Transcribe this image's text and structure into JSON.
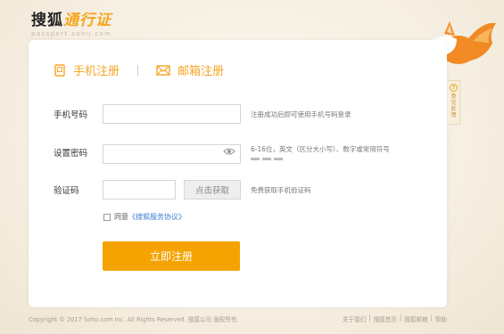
{
  "logo": {
    "brand": "搜狐",
    "product": "通行证",
    "sub": "passport.sohu.com"
  },
  "tabs": [
    {
      "label": "手机注册",
      "icon": "phone-icon"
    },
    {
      "label": "邮箱注册",
      "icon": "mail-icon"
    }
  ],
  "form": {
    "phone": {
      "label": "手机号码",
      "value": "",
      "hint": "注册成功后即可使用手机号码登录"
    },
    "password": {
      "label": "设置密码",
      "value": "",
      "hint": "6-16位，英文（区分大小写）、数字或常用符号"
    },
    "code": {
      "label": "验证码",
      "value": "",
      "button": "点击获取",
      "hint": "免费获取手机验证码"
    },
    "agree": {
      "text": "同意",
      "link": "《搜狐服务协议》",
      "checked": false
    },
    "submit": "立即注册"
  },
  "side_tab": {
    "icon": "question-icon",
    "text": "意见反馈"
  },
  "footer": {
    "copyright": "Copyright © 2017 Sohu.com Inc. All Rights Reserved. 搜狐公司 版权所有",
    "links": [
      "关于我们",
      "搜狐首页",
      "搜狐邮箱",
      "帮助"
    ],
    "separator": "|"
  },
  "colors": {
    "accent": "#f5a623",
    "button": "#f5a300",
    "link": "#3a7bd5"
  }
}
